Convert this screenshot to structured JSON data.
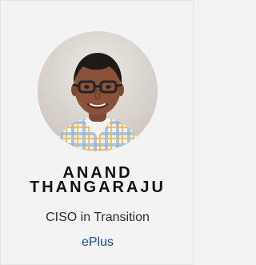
{
  "profile": {
    "name_line1": "ANAND",
    "name_line2": "THANGARAJU",
    "title": "CISO in Transition",
    "company": "ePlus",
    "avatar_alt": "profile photo"
  },
  "colors": {
    "background": "#f3f3f3",
    "name": "#111111",
    "title": "#2e2e2e",
    "company_link": "#1d4f9f"
  }
}
